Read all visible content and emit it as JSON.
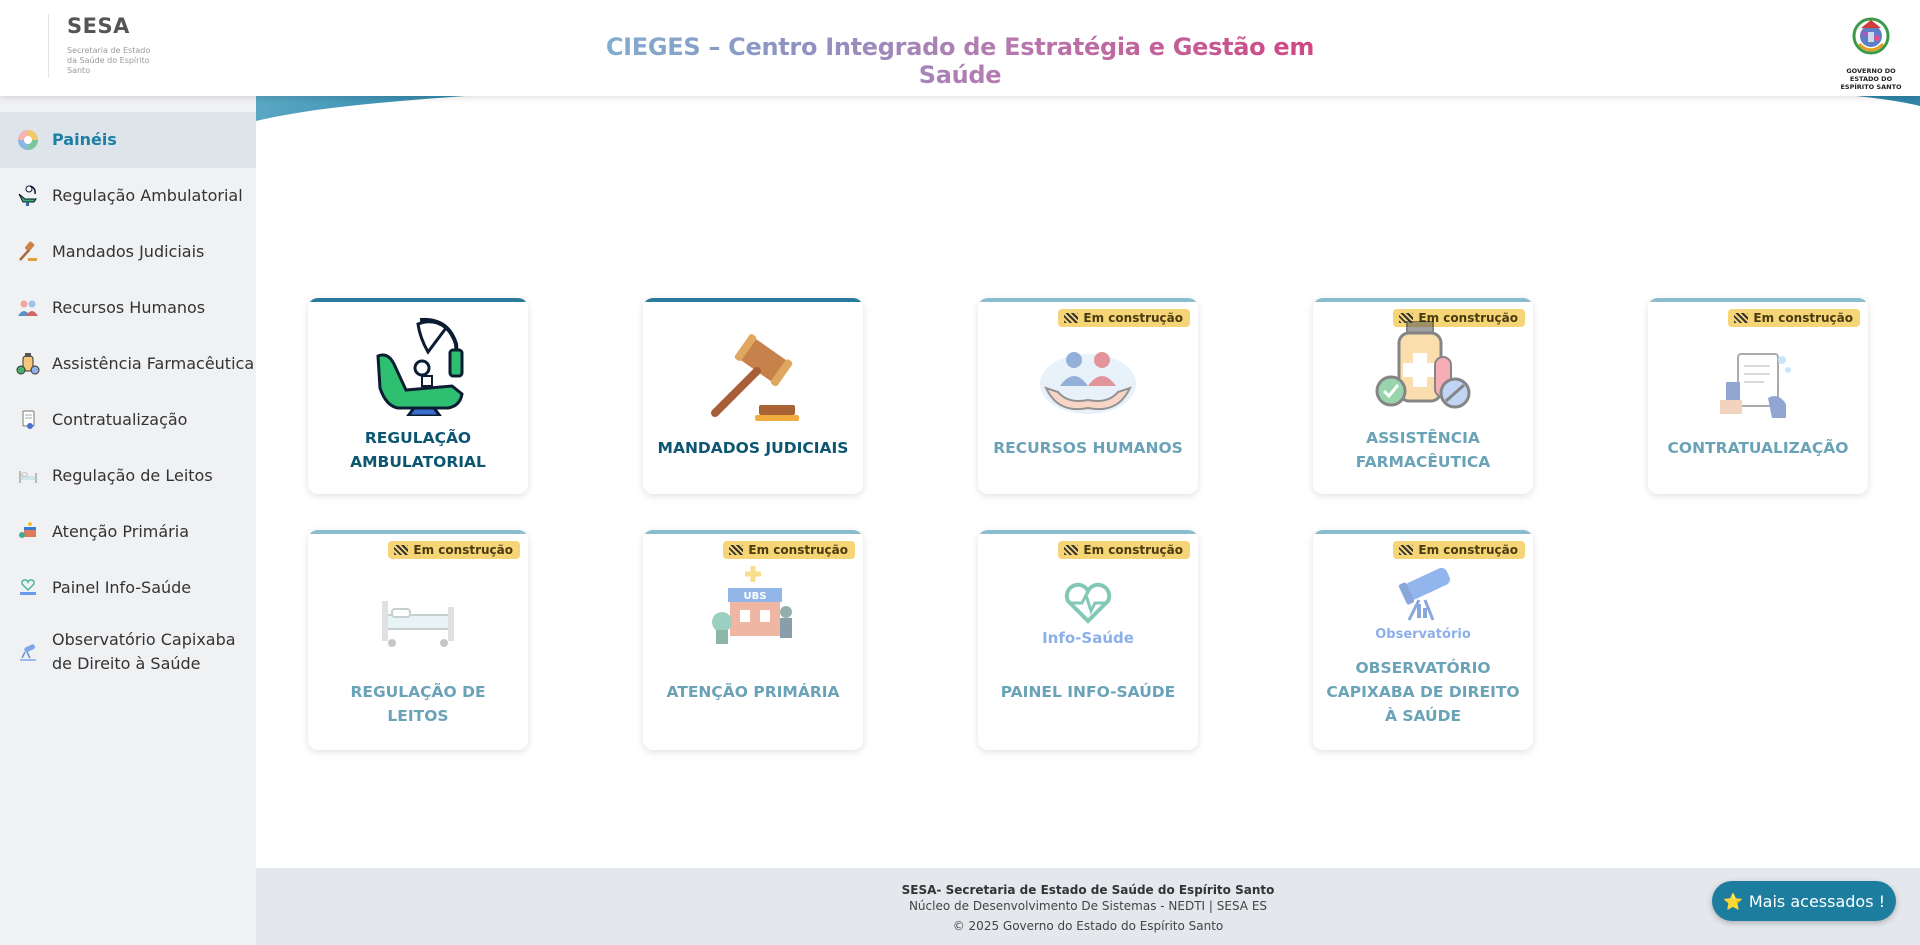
{
  "header": {
    "brand_name": "SESA",
    "brand_sub": "Secretaria de Estado da Saúde do Espírito Santo",
    "title": "CIEGES – Centro Integrado de Estratégia e Gestão em Saúde",
    "gov_logo_text": "GOVERNO DO ESTADO DO ESPÍRITO SANTO"
  },
  "sidebar": {
    "items": [
      {
        "label": "Painéis",
        "icon": "paineis-icon",
        "active": true
      },
      {
        "label": "Regulação Ambulatorial",
        "icon": "dental-chair-icon"
      },
      {
        "label": "Mandados Judiciais",
        "icon": "gavel-icon"
      },
      {
        "label": "Recursos Humanos",
        "icon": "people-icon"
      },
      {
        "label": "Assistência Farmacêutica",
        "icon": "pharmacy-icon"
      },
      {
        "label": "Contratualização",
        "icon": "contract-icon"
      },
      {
        "label": "Regulação de Leitos",
        "icon": "hospital-bed-icon"
      },
      {
        "label": "Atenção Primária",
        "icon": "primary-care-icon"
      },
      {
        "label": "Painel Info-Saúde",
        "icon": "info-saude-icon"
      },
      {
        "label": "Observatório Capixaba de Direito à Saúde",
        "icon": "observatory-icon"
      }
    ]
  },
  "cards": [
    {
      "label": "REGULAÇÃO AMBULATORIAL",
      "icon": "dental-chair-icon",
      "badge": ""
    },
    {
      "label": "MANDADOS JUDICIAIS",
      "icon": "gavel-icon",
      "badge": ""
    },
    {
      "label": "RECURSOS HUMANOS",
      "icon": "people-care-icon",
      "badge": "Em construção"
    },
    {
      "label": "ASSISTÊNCIA FARMACÊUTICA",
      "icon": "pharmacy-icon",
      "badge": "Em construção"
    },
    {
      "label": "CONTRATUALIZAÇÃO",
      "icon": "contract-icon",
      "badge": "Em construção"
    },
    {
      "label": "REGULAÇÃO DE LEITOS",
      "icon": "hospital-bed-icon",
      "badge": "Em construção"
    },
    {
      "label": "ATENÇÃO PRIMÁRIA",
      "icon": "ubs-icon",
      "badge": "Em construção",
      "icon_text": "UBS"
    },
    {
      "label": "PAINEL INFO-SAÚDE",
      "icon": "info-saude-icon",
      "badge": "Em construção",
      "icon_text": "Info-Saúde"
    },
    {
      "label": "OBSERVATÓRIO CAPIXABA DE DIREITO À SAÚDE",
      "icon": "observatory-icon",
      "badge": "Em construção",
      "icon_text": "Observatório"
    }
  ],
  "footer": {
    "line1": "SESA- Secretaria de Estado de Saúde do Espírito Santo",
    "line2": "Núcleo de Desenvolvimento De Sistemas - NEDTI | SESA ES",
    "line3": "© 2025 Governo do Estado do Espírito Santo"
  },
  "fab": {
    "star": "⭐",
    "label": "Mais acessados !"
  },
  "colors": {
    "accent": "#1d7fa3",
    "card_title": "#0c5671",
    "badge_bg": "#f5d576",
    "sidebar_bg": "#f0f1f3"
  }
}
